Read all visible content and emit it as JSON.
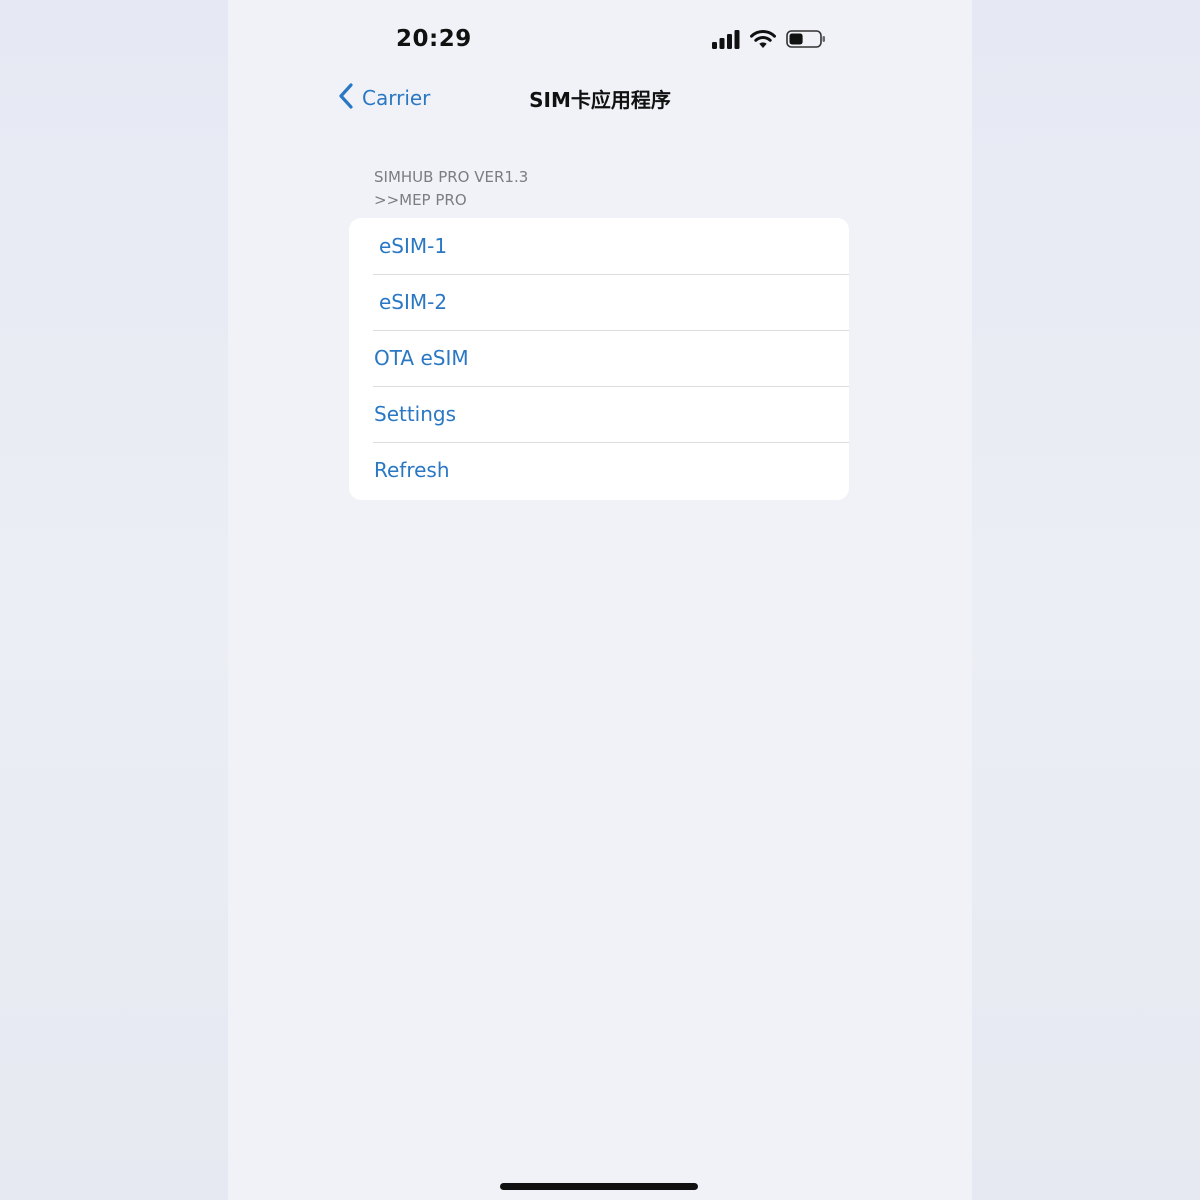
{
  "status_bar": {
    "time": "20:29",
    "icons": [
      "cellular-signal-icon",
      "wifi-icon",
      "battery-icon"
    ],
    "battery_level_percent": 45
  },
  "nav": {
    "back_label": "Carrier",
    "back_icon": "chevron-left-icon",
    "title": "SIM卡应用程序"
  },
  "section": {
    "header_line1": "SIMHUB PRO VER1.3",
    "header_line2": ">>MEP PRO"
  },
  "menu": {
    "items": [
      {
        "label": "eSIM-1"
      },
      {
        "label": "eSIM-2"
      },
      {
        "label": "OTA eSIM"
      },
      {
        "label": "Settings"
      },
      {
        "label": "Refresh"
      }
    ]
  },
  "colors": {
    "accent": "#2a78c3",
    "background": "#f1f2f7",
    "text": "#111111",
    "secondary_text": "#7c7c82"
  }
}
